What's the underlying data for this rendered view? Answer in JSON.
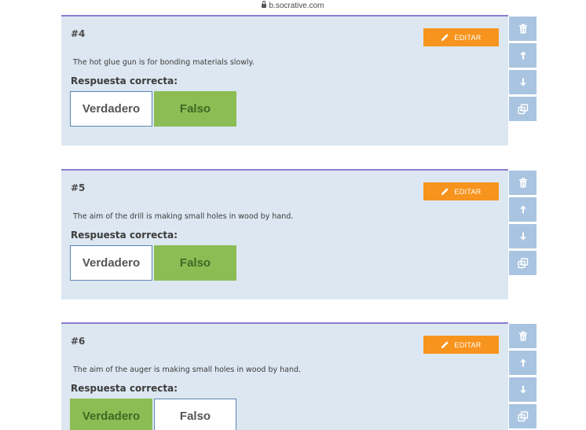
{
  "browser": {
    "url": "b.socrative.com"
  },
  "edit_label": "EDITAR",
  "answer_label": "Respuesta correcta:",
  "options": {
    "true_label": "Verdadero",
    "false_label": "Falso"
  },
  "questions": [
    {
      "number": "#4",
      "text": "The hot glue gun is for bonding materials slowly.",
      "correct": "Falso"
    },
    {
      "number": "#5",
      "text": "The aim of the drill is making small holes in wood by hand.",
      "correct": "Falso"
    },
    {
      "number": "#6",
      "text": "The aim of the auger is making small holes in wood by hand.",
      "correct": "Verdadero"
    }
  ],
  "side_icons": [
    "trash-icon",
    "arrow-up-icon",
    "arrow-down-icon",
    "duplicate-icon"
  ],
  "colors": {
    "card_bg": "#dce7f1",
    "card_top_border": "#8b7dd1",
    "edit_button": "#f7941d",
    "selected_option": "#8cbd55",
    "side_button": "#a9c4e0"
  }
}
